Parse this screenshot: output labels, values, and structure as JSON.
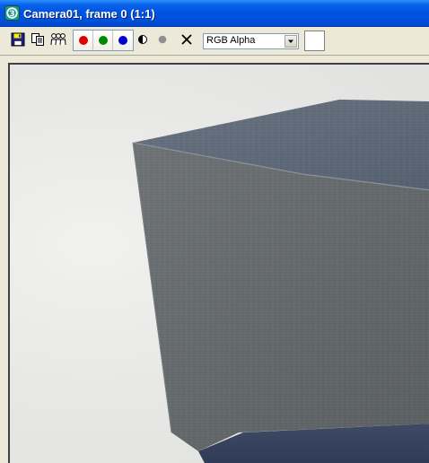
{
  "window": {
    "title": "Camera01, frame 0 (1:1)",
    "app_icon": "3dsmax-app-icon"
  },
  "toolbar": {
    "buttons": [
      {
        "name": "save-image-button",
        "icon": "floppy-disk-icon"
      },
      {
        "name": "clone-window-button",
        "icon": "copy-icon"
      },
      {
        "name": "print-button",
        "icon": "people-icon"
      }
    ],
    "channels": [
      {
        "name": "red-channel-toggle",
        "color": "#e00000"
      },
      {
        "name": "green-channel-toggle",
        "color": "#008a00"
      },
      {
        "name": "blue-channel-toggle",
        "color": "#0000d0"
      }
    ],
    "mono_icon": "monochrome-icon",
    "alpha_icon": "alpha-channel-icon",
    "clear_icon": "clear-x-icon",
    "channel_select": {
      "value": "RGB Alpha"
    },
    "color_swatch": "#ffffff"
  },
  "render": {
    "background_color": "#e8e9e7",
    "box_colors": {
      "front": "#6a6e70",
      "top": "#5e6a78",
      "edge_highlight": "#8b929a"
    }
  }
}
